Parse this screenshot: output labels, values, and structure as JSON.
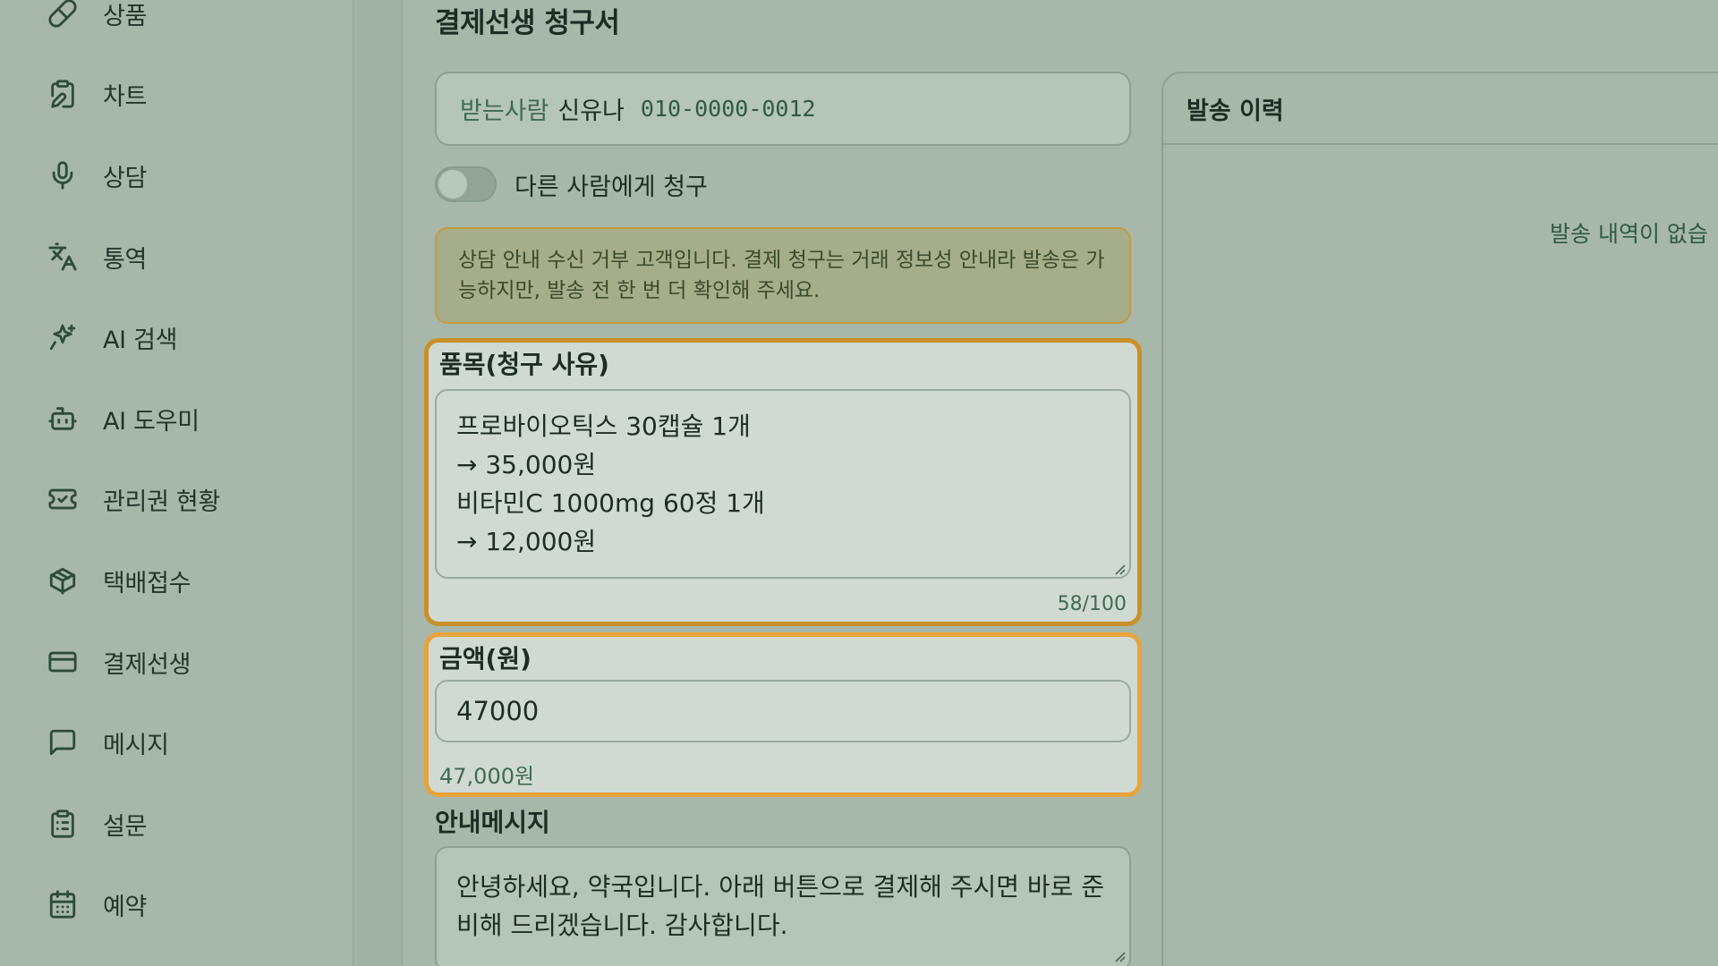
{
  "sidebar": {
    "items": [
      {
        "label": "상품",
        "icon": "pill-icon"
      },
      {
        "label": "차트",
        "icon": "clipboard-edit-icon"
      },
      {
        "label": "상담",
        "icon": "microphone-icon"
      },
      {
        "label": "통역",
        "icon": "translate-icon"
      },
      {
        "label": "AI 검색",
        "icon": "sparkle-search-icon"
      },
      {
        "label": "AI 도우미",
        "icon": "robot-icon"
      },
      {
        "label": "관리권 현황",
        "icon": "ticket-icon"
      },
      {
        "label": "택배접수",
        "icon": "package-icon"
      },
      {
        "label": "결제선생",
        "icon": "credit-card-icon"
      },
      {
        "label": "메시지",
        "icon": "message-square-icon"
      },
      {
        "label": "설문",
        "icon": "clipboard-list-icon"
      },
      {
        "label": "예약",
        "icon": "calendar-icon"
      }
    ]
  },
  "main": {
    "title": "결제선생 청구서",
    "recipient": {
      "label": "받는사람",
      "name": "신유나",
      "phone": "010-0000-0012"
    },
    "toggle": {
      "label": "다른 사람에게 청구",
      "on": false
    },
    "notice": "상담 안내 수신 거부 고객입니다. 결제 청구는 거래 정보성 안내라 발송은 가능하지만, 발송 전 한 번 더 확인해 주세요.",
    "items_field": {
      "label": "품목(청구 사유)",
      "value": "프로바이오틱스 30캡슐 1개\n → 35,000원\n비타민C 1000mg 60정 1개\n → 12,000원",
      "counter": "58/100"
    },
    "amount_field": {
      "label": "금액(원)",
      "value": "47000",
      "formatted": "47,000원"
    },
    "message_field": {
      "label": "안내메시지",
      "value": "안녕하세요, 약국입니다. 아래 버튼으로 결제해 주시면 바로 준비해 드리겠습니다. 감사합니다."
    }
  },
  "history": {
    "title": "발송 이력",
    "empty_text": "발송 내역이 없습"
  },
  "colors": {
    "overlay_bg": "#a7b8ab",
    "highlight_items": "#c9902a",
    "highlight_amount": "#e8a33a",
    "notice_border": "#c59b3c"
  }
}
